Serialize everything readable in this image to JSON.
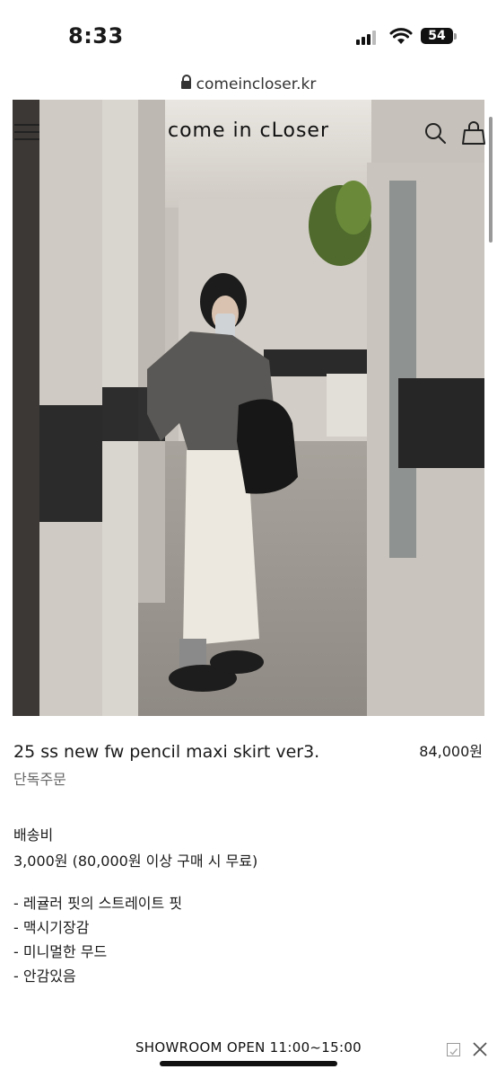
{
  "status_bar": {
    "time": "8:33",
    "battery": "54"
  },
  "browser": {
    "url": "comeincloser.kr"
  },
  "header": {
    "brand": "come in cLoser"
  },
  "hero_image": {
    "alt": ""
  },
  "product": {
    "title": "25 ss new fw pencil maxi skirt ver3.",
    "price": "84,000원",
    "subtitle": "단독주문"
  },
  "shipping": {
    "label": "배송비",
    "value": "3,000원 (80,000원 이상 구매 시 무료)"
  },
  "features": [
    "- 레귤러 핏의 스트레이트 핏",
    "- 맥시기장감",
    "- 미니멀한 무드",
    "- 안감있음"
  ],
  "banner": {
    "text": "SHOWROOM OPEN 11:00~15:00"
  },
  "icons": {
    "menu": "hamburger-menu-icon",
    "search": "search-icon",
    "cart": "shopping-bag-icon",
    "lock": "lock-icon",
    "check": "checkbox-icon",
    "close": "close-icon"
  }
}
